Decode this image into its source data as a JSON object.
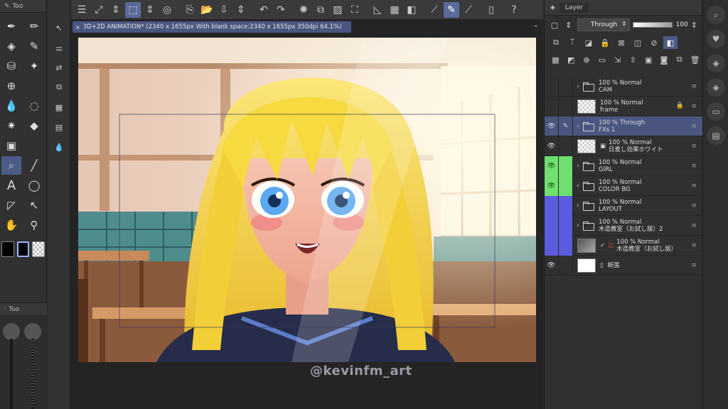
{
  "document": {
    "tab_title": "3D+2D ANIMATION* (2340 x 1655px With blank space:2340 x 1655px 350dpi 64.1%)",
    "close_glyph": "×"
  },
  "watermark": "@kevinfm_art",
  "tool_palette": {
    "header": "Too",
    "tools": [
      "pen-icon",
      "pencil-icon",
      "eraser-icon",
      "ink-icon",
      "fill-icon",
      "sparkle-icon",
      "crosshair-icon",
      "move-icon",
      "blend-icon",
      "lasso-icon",
      "wand-icon",
      "bucket-icon",
      "gradient-icon",
      "empty",
      "magnifier-icon",
      "line-icon",
      "text-icon",
      "balloon-icon",
      "ruler-icon",
      "selector-icon",
      "hand-icon",
      "eyedropper-icon"
    ],
    "sub_header": "Too"
  },
  "layer_panel": {
    "tab": "Layer",
    "blend_mode": "Through",
    "opacity": "100",
    "layers": [
      {
        "id": "cam",
        "opacity": "100 %",
        "mode": "Normal",
        "name": "CAM",
        "type": "folder",
        "eye": "",
        "c2": "",
        "color": "none",
        "selected": false,
        "locked": false
      },
      {
        "id": "frame",
        "opacity": "100 %",
        "mode": "Normal",
        "name": "frame",
        "type": "raster",
        "eye": "",
        "c2": "",
        "color": "none",
        "selected": false,
        "locked": true
      },
      {
        "id": "fxs1",
        "opacity": "100 %",
        "mode": "Through",
        "name": "FXs 1",
        "type": "folder",
        "eye": "👁",
        "c2": "✎",
        "color": "none",
        "selected": true,
        "locked": false
      },
      {
        "id": "sunlight",
        "opacity": "100 %",
        "mode": "Normal",
        "name": "日差し効果ホワイト",
        "type": "material",
        "eye": "👁",
        "c2": "",
        "color": "none",
        "selected": false,
        "locked": false
      },
      {
        "id": "girl",
        "opacity": "100 %",
        "mode": "Normal",
        "name": "GIRL",
        "type": "folder",
        "eye": "👁",
        "c2": "",
        "color": "green",
        "selected": false,
        "locked": false
      },
      {
        "id": "colorbg",
        "opacity": "100 %",
        "mode": "Normal",
        "name": "COLOR BG",
        "type": "folder",
        "eye": "👁",
        "c2": "",
        "color": "green",
        "selected": false,
        "locked": false
      },
      {
        "id": "layout",
        "opacity": "100 %",
        "mode": "Normal",
        "name": "LAYOUT",
        "type": "folder",
        "eye": "",
        "c2": "",
        "color": "blue",
        "selected": false,
        "locked": false
      },
      {
        "id": "classroom2",
        "opacity": "100 %",
        "mode": "Normal",
        "name": "木造教室（お試し版）2",
        "type": "folder",
        "eye": "",
        "c2": "",
        "color": "blue",
        "selected": false,
        "locked": false
      },
      {
        "id": "classroom",
        "opacity": "100 %",
        "mode": "Normal",
        "name": "木造教室（お試し版）",
        "type": "3d",
        "eye": "",
        "c2": "",
        "color": "blue",
        "selected": false,
        "locked": false
      },
      {
        "id": "paper",
        "opacity": "",
        "mode": "",
        "name": "紙張",
        "type": "paper",
        "eye": "👁",
        "c2": "",
        "color": "none",
        "selected": false,
        "locked": false
      }
    ]
  },
  "colors": {
    "selected_layer": "#4a5680",
    "color_label_green": "#6fe06f",
    "color_label_blue": "#5b5bdd",
    "hair": "#f4d23a",
    "eyes": "#5aa8f0"
  }
}
